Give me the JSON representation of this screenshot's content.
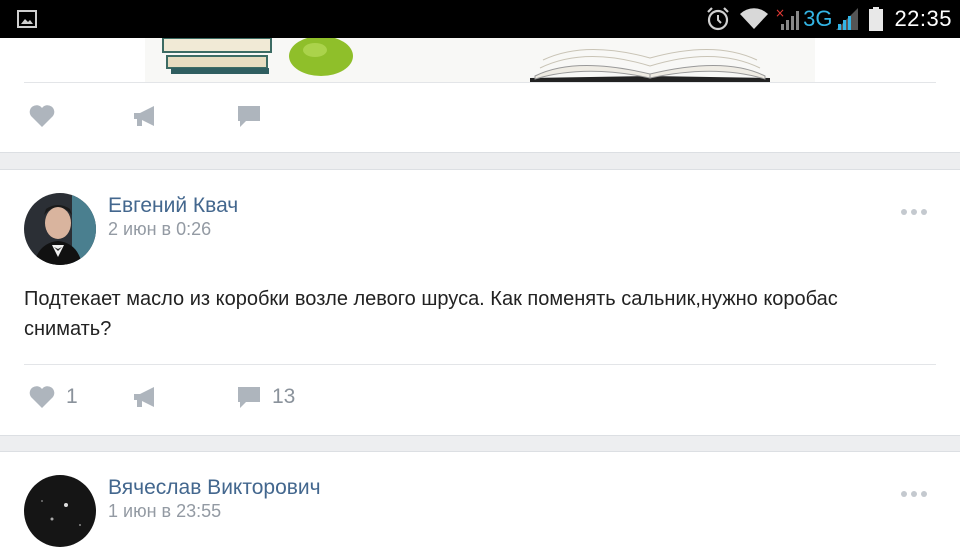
{
  "status_bar": {
    "time": "22:35",
    "network": "3G",
    "icons": [
      "image-icon",
      "alarm-icon",
      "wifi-icon",
      "signal-icon",
      "battery-icon"
    ]
  },
  "posts": [
    {
      "likes": "",
      "comments": ""
    },
    {
      "author": "Евгений Квач",
      "date": "2 июн в 0:26",
      "text": "Подтекает масло из коробки возле левого шруса. Как поменять сальник,нужно коробас снимать?",
      "likes": "1",
      "comments": "13"
    },
    {
      "author": "Вячеслав Викторович",
      "date": "1 июн в 23:55"
    }
  ],
  "colors": {
    "accent": "#43678e",
    "icon_gray": "#aeb5bd",
    "status_blue": "#33b5e5"
  }
}
